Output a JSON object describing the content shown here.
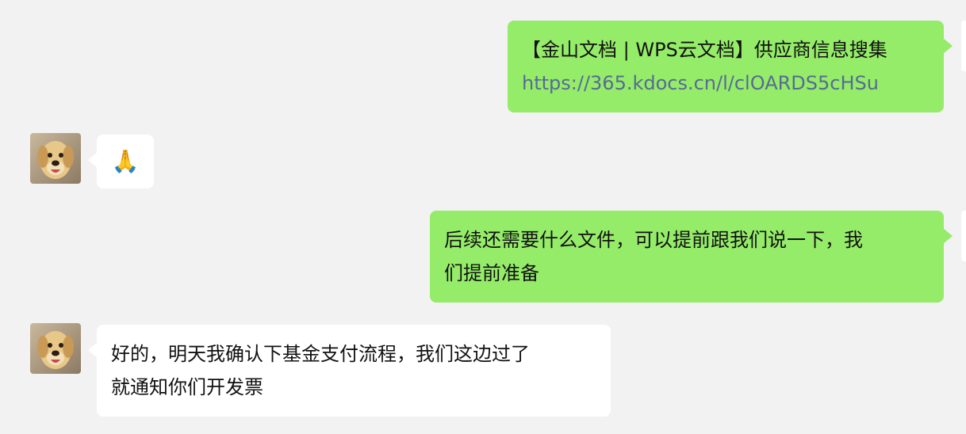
{
  "messages": [
    {
      "direction": "outgoing",
      "lines": [
        "【金山文档 | WPS云文档】供应商信息搜集"
      ],
      "link": "https://365.kdocs.cn/l/clOARDS5cHSu"
    },
    {
      "direction": "incoming",
      "emoji": "🙏",
      "emoji_icon": "folded-hands-icon"
    },
    {
      "direction": "outgoing",
      "lines": [
        "后续还需要什么文件，可以提前跟我们说一下，我",
        "们提前准备"
      ]
    },
    {
      "direction": "incoming",
      "lines": [
        "好的，明天我确认下基金支付流程，我们这边过了",
        "就通知你们开发票"
      ]
    }
  ],
  "colors": {
    "background": "#f2f2f2",
    "outgoing_bubble": "#95ec69",
    "incoming_bubble": "#ffffff",
    "link": "#576b95"
  },
  "avatars": {
    "contact": "dog-avatar"
  }
}
